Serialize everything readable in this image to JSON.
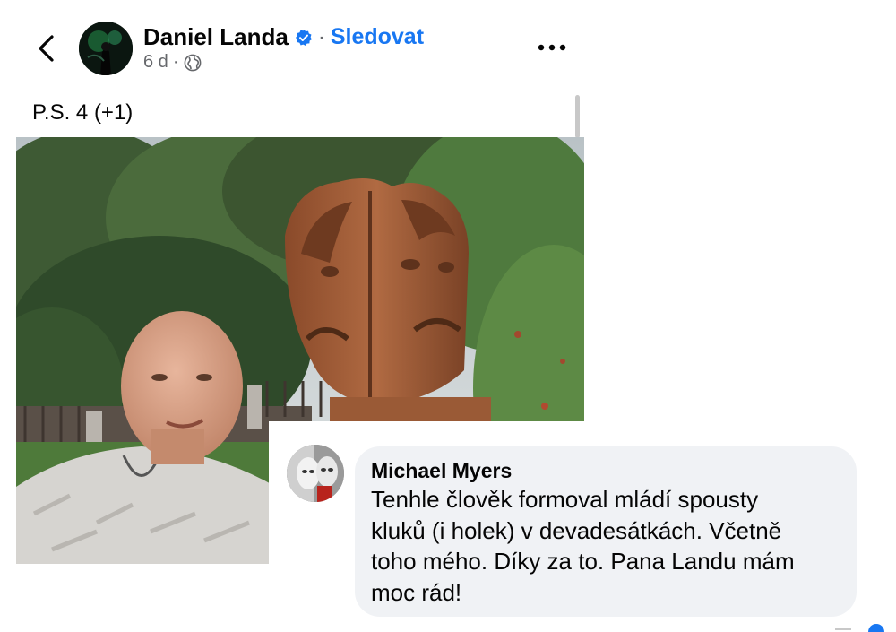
{
  "post": {
    "author": "Daniel Landa",
    "separator": "·",
    "follow_label": "Sledovat",
    "time": "6 d",
    "meta_separator": "·",
    "text": "P.S. 4 (+1)"
  },
  "icons": {
    "back": "chevron-left-icon",
    "verified": "verified-badge-icon",
    "privacy": "globe-icon",
    "more": "more-dots-icon"
  },
  "comment": {
    "author": "Michael Myers",
    "text": "Tenhle člověk formoval mládí spousty\nkluků (i holek) v devadesátkách. Včetně\ntoho mého. Díky za to. Pana Landu mám\nmoc rád!"
  },
  "colors": {
    "accent": "#1877f2",
    "secondary_text": "#65676b",
    "bubble": "#f0f2f5"
  }
}
